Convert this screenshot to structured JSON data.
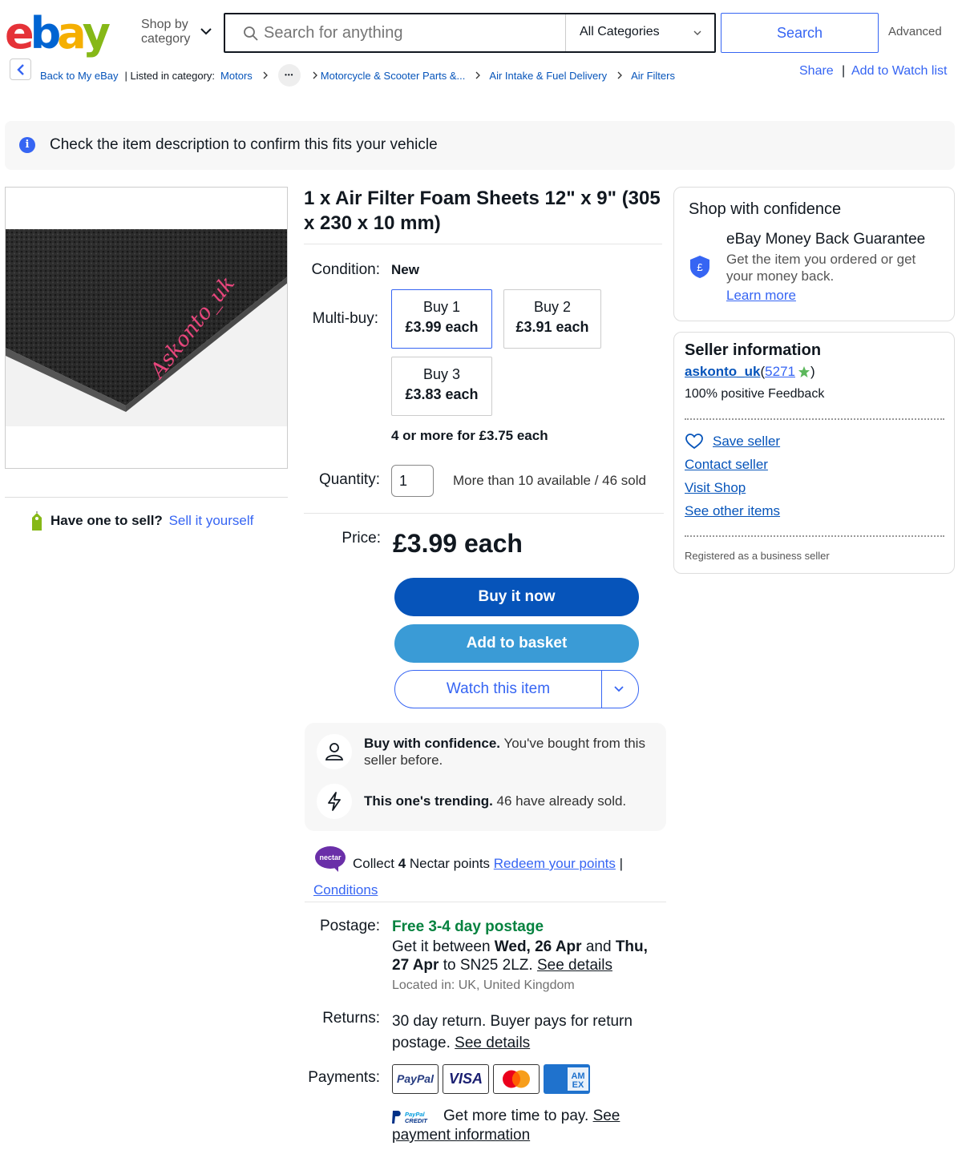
{
  "header": {
    "logo_letters": [
      "e",
      "b",
      "a",
      "y"
    ],
    "logo_colors": [
      "#e53238",
      "#0064d2",
      "#f5af02",
      "#86b817"
    ],
    "shop_by_line1": "Shop by",
    "shop_by_line2": "category",
    "search_placeholder": "Search for anything",
    "category_value": "All Categories",
    "search_button": "Search",
    "advanced_label": "Advanced"
  },
  "breadcrumb": {
    "back_label": "Back to My eBay",
    "listed_in": "| Listed in category:",
    "items": [
      "Motors",
      "Motorcycle & Scooter Parts &...",
      "Air Intake & Fuel Delivery",
      "Air Filters"
    ],
    "ellipsis": "•••"
  },
  "actions": {
    "share": "Share",
    "separator": "|",
    "watch_list": "Add to Watch list"
  },
  "notice": {
    "icon": "i",
    "text": "Check the item description to confirm this fits your vehicle"
  },
  "image": {
    "watermark": "Askonto_uk"
  },
  "sell": {
    "question": "Have one to sell?",
    "link": "Sell it yourself"
  },
  "listing": {
    "title": "1 x Air Filter Foam Sheets 12\" x 9\" (305 x 230 x 10 mm)",
    "condition_label": "Condition:",
    "condition_value": "New",
    "multibuy_label": "Multi-buy:",
    "multibuy_options": [
      {
        "qty": "Buy 1",
        "price": "£3.99 each",
        "selected": true
      },
      {
        "qty": "Buy 2",
        "price": "£3.91 each",
        "selected": false
      },
      {
        "qty": "Buy 3",
        "price": "£3.83 each",
        "selected": false
      }
    ],
    "four_or_more": "4 or more for £3.75 each",
    "quantity_label": "Quantity:",
    "quantity_value": "1",
    "availability": "More than 10 available / 46 sold",
    "price_label": "Price:",
    "price": "£3.99 each",
    "buy_now": "Buy it now",
    "add_basket": "Add to basket",
    "watch_item": "Watch this item"
  },
  "confidence_panel": {
    "line1_bold": "Buy with confidence.",
    "line1_rest": " You've bought from this seller before.",
    "line2_bold": "This one's trending.",
    "line2_rest": " 46 have already sold."
  },
  "nectar": {
    "logo_text": "nectar",
    "collect": "Collect ",
    "points": "4",
    "points_rest": " Nectar points ",
    "redeem": "Redeem your points",
    "bar": " |",
    "conditions": "Conditions"
  },
  "postage": {
    "label": "Postage:",
    "free": "Free 3-4 day postage",
    "get_it": "Get it between ",
    "date1": "Wed, 26 Apr",
    "and": " and ",
    "date2": "Thu, 27 Apr",
    "to": " to SN25 2LZ. ",
    "see_details": "See details",
    "located": "Located in: UK, United Kingdom"
  },
  "returns": {
    "label": "Returns:",
    "text": "30 day return. Buyer pays for return postage. ",
    "see_details": "See details"
  },
  "payments": {
    "label": "Payments:",
    "cards": [
      "PayPal",
      "VISA",
      "Mastercard",
      "American Express"
    ],
    "paypal_credit_logo": "PayPal CREDIT",
    "credit_text": "Get more time to pay. ",
    "credit_link": "See payment information"
  },
  "shop_confidence": {
    "title": "Shop with confidence",
    "shield_symbol": "£",
    "guarantee": "eBay Money Back Guarantee",
    "desc": "Get the item you ordered or get your money back.",
    "learn_more": "Learn more"
  },
  "seller": {
    "title": "Seller information",
    "name": "askonto_uk",
    "open_paren": " (",
    "rating": "5271",
    "close_paren": ")",
    "feedback": "100% positive Feedback",
    "links": [
      "Save seller",
      "Contact seller",
      "Visit Shop",
      "See other items"
    ],
    "registered": "Registered as a business seller"
  },
  "colors": {
    "ebay_blue": "#3665f3",
    "buy_now_bg": "#0654ba",
    "basket_bg": "#3a9bd6",
    "free_postage_green": "#05823f",
    "nectar_purple": "#6a2fa8"
  }
}
